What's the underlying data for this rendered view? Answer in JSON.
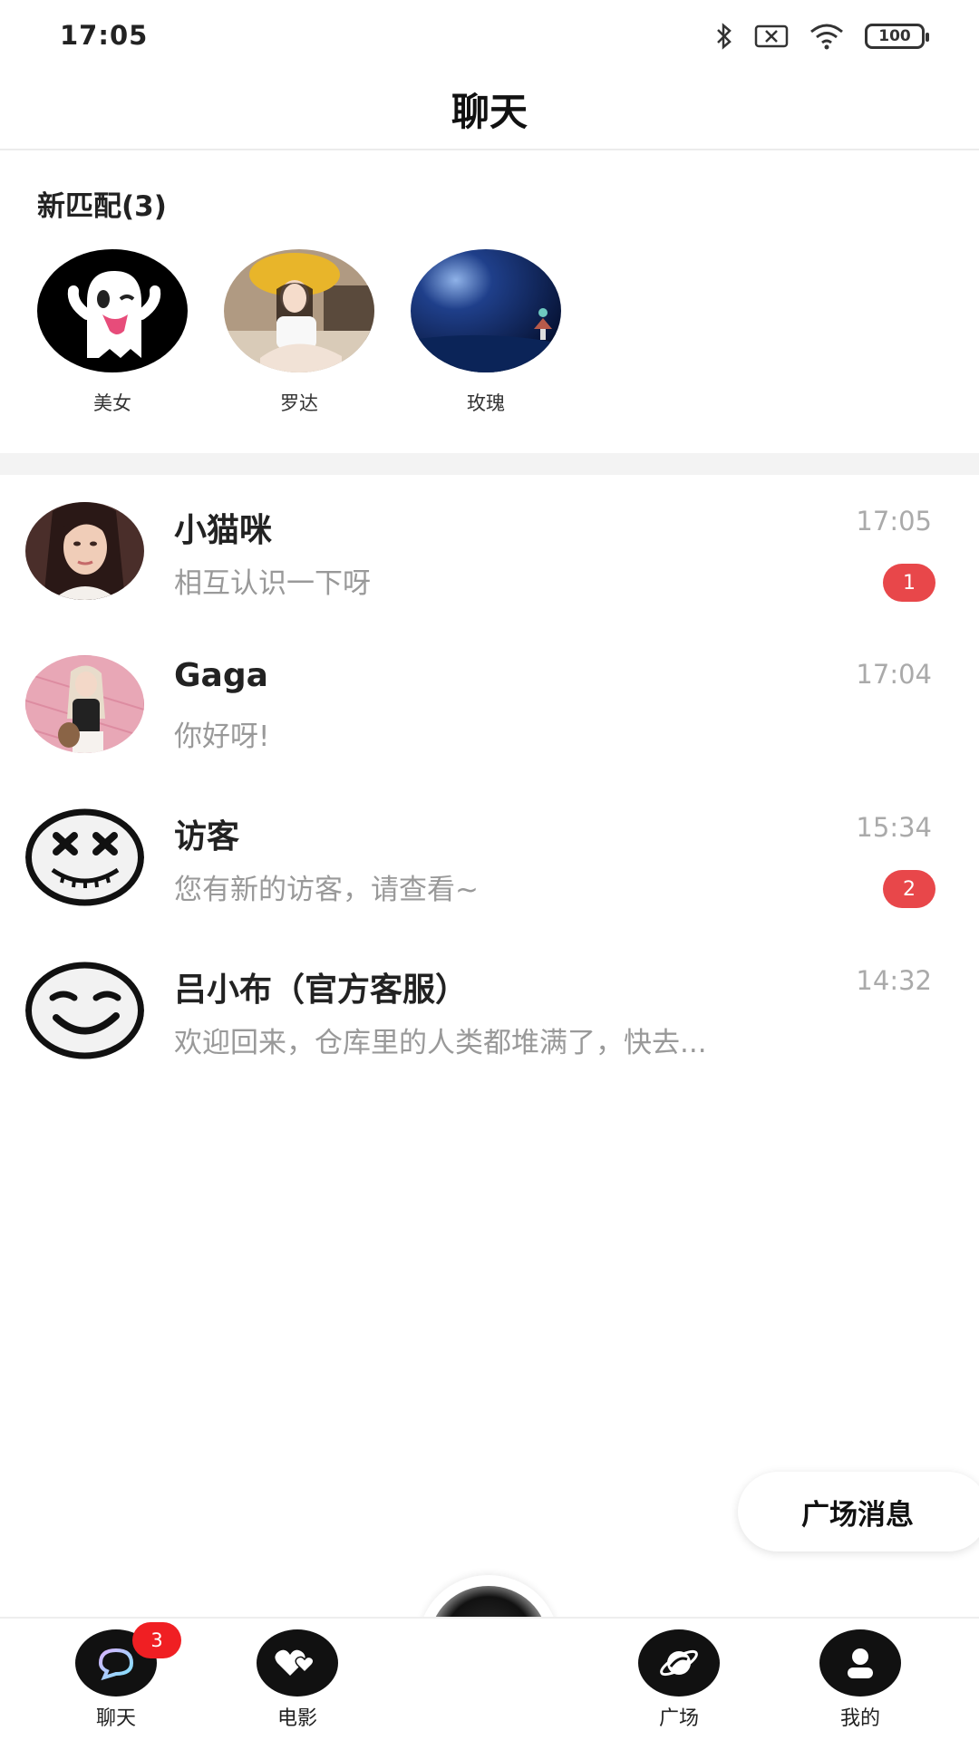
{
  "status_bar": {
    "time": "17:05",
    "battery": "100",
    "icons": [
      "bluetooth-icon",
      "sim-off-icon",
      "wifi-icon",
      "battery-icon"
    ]
  },
  "header": {
    "title": "聊天"
  },
  "new_matches": {
    "title": "新匹配(3)",
    "items": [
      {
        "name": "美女",
        "avatar": "ghost-emoji-avatar"
      },
      {
        "name": "罗达",
        "avatar": "girl-photo-avatar"
      },
      {
        "name": "玫瑰",
        "avatar": "night-sky-avatar"
      }
    ]
  },
  "conversations": [
    {
      "name": "小猫咪",
      "preview": "相互认识一下呀",
      "time": "17:05",
      "unread": "1"
    },
    {
      "name": "Gaga",
      "preview": "你好呀!",
      "time": "17:04",
      "unread": ""
    },
    {
      "name": "访客",
      "preview": "您有新的访客，请查看~",
      "time": "15:34",
      "unread": "2"
    },
    {
      "name": "吕小布（官方客服）",
      "preview": "欢迎回来，仓库里的人类都堆满了，快去...",
      "time": "14:32",
      "unread": ""
    }
  ],
  "plaza_fab": {
    "label": "广场消息"
  },
  "bottom_nav": {
    "items": [
      {
        "label": "聊天",
        "icon": "chat-bubble-icon",
        "badge": "3"
      },
      {
        "label": "电影",
        "icon": "hearts-icon",
        "badge": ""
      },
      {
        "label": "",
        "icon": "astronaut-icon",
        "badge": ""
      },
      {
        "label": "广场",
        "icon": "planet-icon",
        "badge": ""
      },
      {
        "label": "我的",
        "icon": "user-icon",
        "badge": ""
      }
    ]
  },
  "colors": {
    "badge_red": "#e8474a",
    "nav_badge_red": "#f01f23",
    "divider": "#f3f3f3"
  }
}
